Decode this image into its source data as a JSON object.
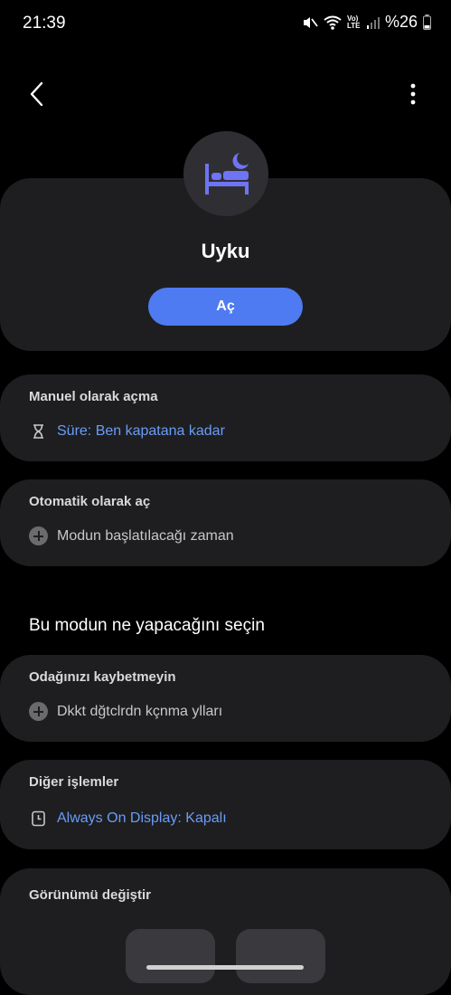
{
  "status_bar": {
    "time": "21:39",
    "network_label": "Vo) LTE",
    "battery": "%26",
    "icons": [
      "mute-icon",
      "wifi-icon",
      "volte-icon",
      "signal-icon",
      "battery-icon"
    ]
  },
  "header": {
    "back_icon": "chevron-left-icon",
    "more_icon": "more-vertical-icon"
  },
  "mode": {
    "icon": "bed-moon-icon",
    "title": "Uyku",
    "turn_on_label": "Aç"
  },
  "manual": {
    "title": "Manuel olarak açma",
    "duration_label": "Süre: Ben kapatana kadar",
    "duration_icon": "hourglass-icon"
  },
  "automatic": {
    "title": "Otomatik olarak aç",
    "add_label": "Modun başlatılacağı zaman",
    "add_icon": "add-circle-icon"
  },
  "section_heading": "Bu modun ne yapacağını seçin",
  "focus": {
    "title": "Odağınızı kaybetmeyin",
    "add_label": "Dkkt dğtclrdn kçnma ylları",
    "add_icon": "add-circle-icon"
  },
  "other": {
    "title": "Diğer işlemler",
    "aod_label": "Always On Display: Kapalı",
    "aod_icon": "clock-display-icon"
  },
  "appearance": {
    "title": "Görünümü değiştir"
  },
  "colors": {
    "background": "#000000",
    "card": "#1e1e20",
    "accent_button": "#4e7bf2",
    "link_blue": "#6a9cf6",
    "icon_purple": "#6f74f4"
  }
}
